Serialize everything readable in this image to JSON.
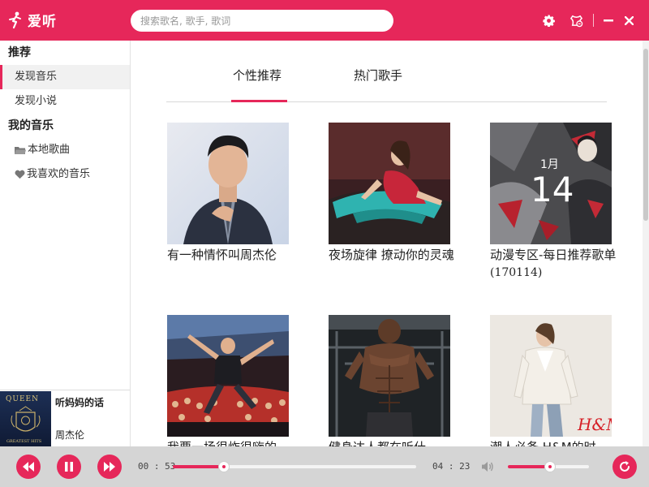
{
  "app": {
    "title": "爱听",
    "brand_color": "#e6275a"
  },
  "search": {
    "placeholder": "搜索歌名, 歌手, 歌词"
  },
  "titlebar": {
    "icons": [
      "gear-icon",
      "skin-icon",
      "minimize-icon",
      "close-icon"
    ]
  },
  "sidebar": {
    "section_recommend": "推荐",
    "items_recommend": [
      {
        "label": "发现音乐",
        "active": true
      },
      {
        "label": "发现小说"
      }
    ],
    "section_mymusic": "我的音乐",
    "items_mymusic": [
      {
        "label": "本地歌曲",
        "icon": "folder-icon"
      },
      {
        "label": "我喜欢的音乐",
        "icon": "heart-icon"
      }
    ]
  },
  "tabs": [
    {
      "label": "个性推荐",
      "active": true
    },
    {
      "label": "热门歌手"
    }
  ],
  "cards": [
    {
      "caption": "有一种情怀叫周杰伦"
    },
    {
      "caption": "夜场旋律 撩动你的灵魂"
    },
    {
      "caption_text": "动漫专区-每日推荐歌单",
      "caption_num": "(170114)",
      "date_month": "1月",
      "date_day": "14"
    },
    {
      "caption": "我要一场很炸很嗨的"
    },
    {
      "caption": "健身达人都在听什"
    },
    {
      "caption": "潮人必备 H&M的时"
    }
  ],
  "now_playing": {
    "title": "听妈妈的话",
    "artist": "周杰伦",
    "cover_text": "QUEEN",
    "cover_subtext": "GREATEST HITS"
  },
  "player": {
    "current_time": "00 : 53",
    "total_time": "04 : 23",
    "progress": 0.21,
    "volume": 0.52,
    "icons": [
      "prev-icon",
      "pause-icon",
      "next-icon",
      "volume-icon",
      "loop-icon"
    ]
  }
}
